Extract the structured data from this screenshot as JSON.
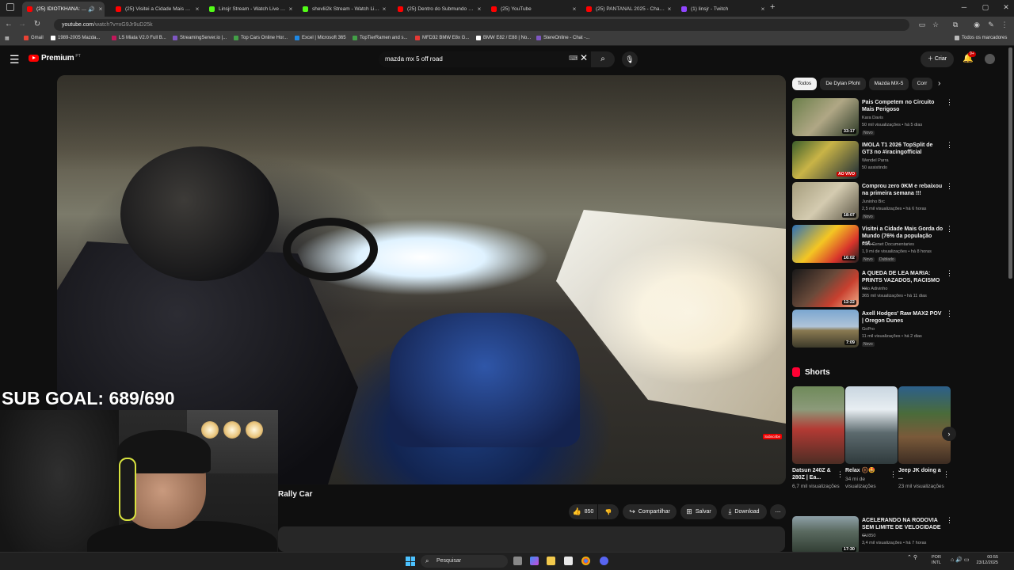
{
  "browser": {
    "tabs": [
      {
        "label": "(25) IDIOTKHANA: Gymkha",
        "active": true,
        "color": "#ff0000"
      },
      {
        "label": "(25) Visitei a Cidade Mais Gorda",
        "active": false,
        "color": "#ff0000"
      },
      {
        "label": "Linsjr Stream - Watch Live on K",
        "active": false,
        "color": "#53fc18"
      },
      {
        "label": "shevlii2k Stream - Watch Live o",
        "active": false,
        "color": "#53fc18"
      },
      {
        "label": "(25) Dentro do Submundo Beg",
        "active": false,
        "color": "#ff0000"
      },
      {
        "label": "(25) YouTube",
        "active": false,
        "color": "#ff0000"
      },
      {
        "label": "(25) PANTANAL 2025 - Chapec",
        "active": false,
        "color": "#ff0000"
      },
      {
        "label": "(1) linsjr - Twitch",
        "active": false,
        "color": "#9146ff"
      }
    ],
    "new_tab": "+",
    "url_host": "youtube.com",
    "url_path": "/watch?v=xG9Jr9uD25k",
    "bookmarks": [
      {
        "label": "Gmail",
        "color": "#ea4335"
      },
      {
        "label": "1989-2005 Mazda...",
        "color": "#ffffff"
      },
      {
        "label": "LS Miata V2.0 Full B...",
        "color": "#c2185b"
      },
      {
        "label": "StreamingServer.io |...",
        "color": "#7e57c2"
      },
      {
        "label": "Top Cars Online Hor...",
        "color": "#43a047"
      },
      {
        "label": "Excel | Microsoft 365",
        "color": "#1e88e5"
      },
      {
        "label": "TopTierRamen and s...",
        "color": "#43a047"
      },
      {
        "label": "MFD32 BMW E8x G...",
        "color": "#e53935"
      },
      {
        "label": "BMW E82 / E88 | No...",
        "color": "#ffffff"
      },
      {
        "label": "StereOnline - Chat -...",
        "color": "#7e57c2"
      }
    ],
    "all_bookmarks": "Todos os marcadores"
  },
  "youtube": {
    "logo_word": "Premium",
    "logo_country": "PT",
    "search_query": "mazda mx 5 off road",
    "create_label": "Criar",
    "notif_count": "9+",
    "video_title": "Rally Car",
    "subscribe_badge": "Subscribe",
    "actions": {
      "likes": "850",
      "share": "Compartilhar",
      "save": "Salvar",
      "download": "Download"
    },
    "chips": [
      "Todos",
      "De Dylan Pfohl",
      "Mazda MX-5",
      "Corr"
    ],
    "recommendations": [
      {
        "title": "Pais Competem no Circuito Mais Perigoso",
        "channel": "Kara Davis",
        "meta": "50 mil visualizações • há 5 dias",
        "badge": "Novo",
        "duration": "33:17"
      },
      {
        "title": "IMOLA T1 2026 TopSplit de GT3 no #iracingofficial",
        "channel": "Wendel Parra",
        "meta": "50 assistindo",
        "badge": "",
        "duration": "AO VIVO"
      },
      {
        "title": "Comprou zero 0KM e rebaixou na primeira semana !!!",
        "channel": "Juninho Brc",
        "meta": "2,5 mil visualizações • há 6 horas",
        "badge": "Novo",
        "duration": "18:07"
      },
      {
        "title": "Visitei a Cidade Mais Gorda do Mundo (76% da população est...",
        "channel": "Ruhi Cenet Documentaries",
        "meta": "1,9 mi de visualizações • há 8 horas",
        "badge": "Novo",
        "badge2": "Dublado",
        "duration": "16:02"
      },
      {
        "title": "A QUEDA DE LEA MARIA: PRINTS VAZADOS, RACISMO ...",
        "channel": "Não Adivinho",
        "meta": "365 mil visualizações • há 11 dias",
        "badge": "",
        "duration": "12:22"
      },
      {
        "title": "Axell Hodges' Raw MAX2 POV | Oregon Dunes",
        "channel": "GoPro",
        "meta": "11 mil visualizações • há 2 dias",
        "badge": "Novo",
        "duration": "7:09"
      }
    ],
    "shorts_heading": "Shorts",
    "shorts": [
      {
        "title": "Datsun 240Z & 280Z | Ea...",
        "views": "6,7 mil visualizações"
      },
      {
        "title": "Relax 🛞🤩",
        "views": "34 mi de visualizações"
      },
      {
        "title": "Jeep JK doing a ...",
        "views": "23 mil visualizações"
      }
    ],
    "bottom_rec": {
      "title": "ACELERANDO NA RODOVIA SEM LIMITE DE VELOCIDADE ...",
      "channel": "GU850",
      "meta": "3,4 mil visualizações • há 7 horas",
      "duration": "17:30"
    }
  },
  "overlay": {
    "sub_goal": "SUB GOAL: 689/690"
  },
  "taskbar": {
    "search": "Pesquisar",
    "lang_top": "POR",
    "lang_bottom": "INTL",
    "time": "00:55",
    "date": "23/12/2025"
  }
}
